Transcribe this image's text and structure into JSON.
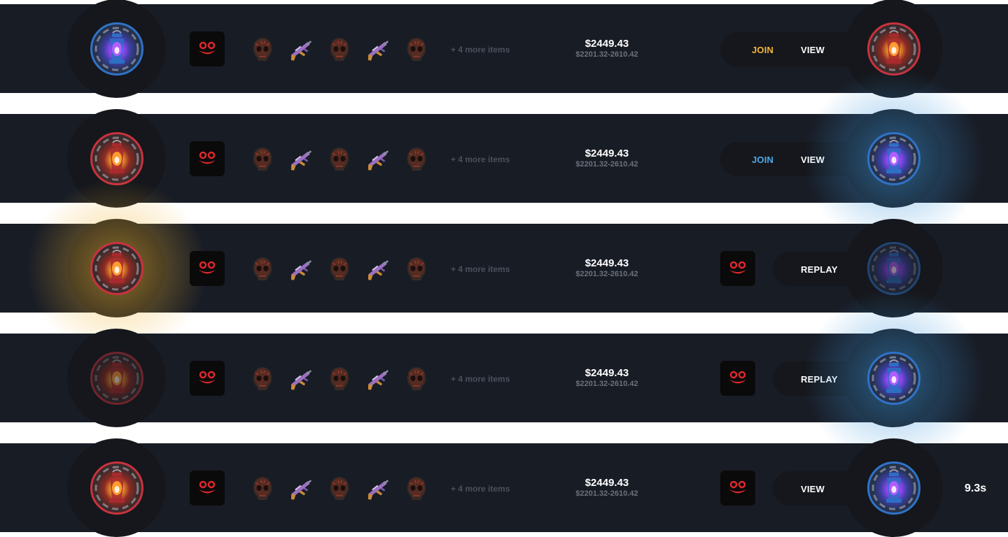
{
  "more_items_label": "+ 4 more items",
  "price": "$2449.43",
  "price_range": "$2201.32-2610.42",
  "labels": {
    "join": "JOIN",
    "view": "VIEW",
    "replay": "REPLAY"
  },
  "colors": {
    "row_background": "#181c25",
    "circle_background": "#15171c",
    "team_red": "#c9323d",
    "team_blue": "#2f73c8",
    "join_gold": "#f2b43a",
    "join_blue": "#4da9e8",
    "muted_text": "#4b505c"
  },
  "items": [
    "skull-mask-icon",
    "rifle-icon",
    "skull-mask-icon",
    "rifle-icon",
    "skull-mask-icon"
  ],
  "games": [
    {
      "left_chip": "blue",
      "right_chip": "red",
      "state": "open",
      "join_color": "gold",
      "opponent": false
    },
    {
      "left_chip": "red",
      "right_chip": "blue",
      "state": "open",
      "join_color": "blue",
      "right_glow": "blue",
      "opponent": false
    },
    {
      "left_chip": "red",
      "right_chip": "blue",
      "state": "finished",
      "left_glow": "gold",
      "right_dim": true,
      "opponent": true
    },
    {
      "left_chip": "red",
      "right_chip": "blue",
      "state": "finished",
      "left_dim": true,
      "right_glow": "blue",
      "opponent": true
    },
    {
      "left_chip": "red",
      "right_chip": "blue",
      "state": "running",
      "opponent": true,
      "timer": "9.3s"
    }
  ]
}
